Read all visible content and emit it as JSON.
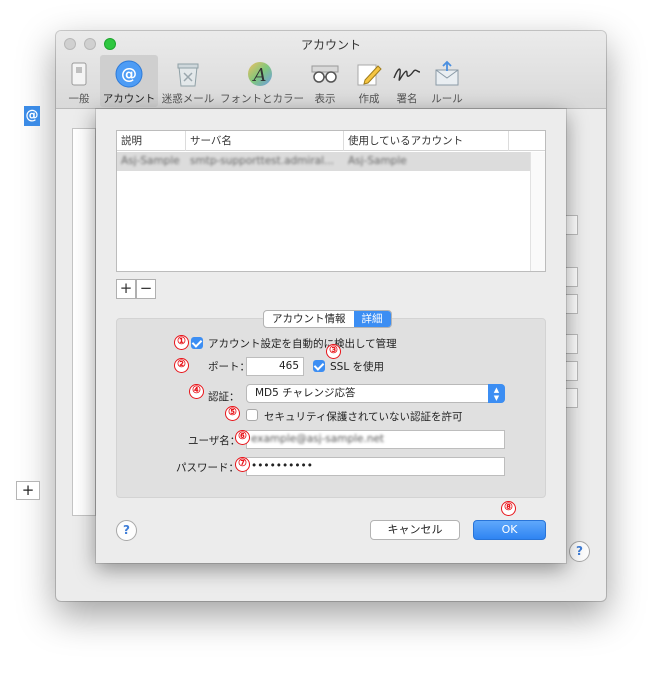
{
  "window": {
    "title": "アカウント",
    "toolbar": [
      {
        "label": "一般",
        "icon": "general-switch-icon"
      },
      {
        "label": "アカウント",
        "icon": "at-sign-icon",
        "selected": true
      },
      {
        "label": "迷惑メール",
        "icon": "junk-mail-bin-icon"
      },
      {
        "label": "フォントとカラー",
        "icon": "font-color-icon"
      },
      {
        "label": "表示",
        "icon": "glasses-icon"
      },
      {
        "label": "作成",
        "icon": "pencil-icon"
      },
      {
        "label": "署名",
        "icon": "signature-icon"
      },
      {
        "label": "ルール",
        "icon": "rules-envelope-icon"
      }
    ],
    "plus_label": "+",
    "help_label": "?"
  },
  "sheet": {
    "table": {
      "columns": [
        "説明",
        "サーバ名",
        "使用しているアカウント"
      ],
      "rows": [
        [
          "Asj-Sample",
          "smtp-supporttest.admiral...",
          "Asj-Sample"
        ]
      ]
    },
    "add_label": "+",
    "remove_label": "−",
    "tabs": [
      {
        "label": "アカウント情報",
        "active": false
      },
      {
        "label": "詳細",
        "active": true
      }
    ],
    "auto_detect_label": "アカウント設定を自動的に検出して管理",
    "auto_detect_checked": true,
    "port_label": "ポート：",
    "port_value": "465",
    "ssl_label": "SSL を使用",
    "ssl_checked": true,
    "auth_label": "認証：",
    "auth_value": "MD5 チャレンジ応答",
    "insecure_label": "セキュリティ保護されていない認証を許可",
    "insecure_checked": false,
    "username_label": "ユーザ名：",
    "username_value": "example@asj-sample.net",
    "password_label": "パスワード：",
    "password_value": "••••••••••",
    "cancel_label": "キャンセル",
    "ok_label": "OK",
    "help_label": "?"
  },
  "annotations": [
    "①",
    "②",
    "③",
    "④",
    "⑤",
    "⑥",
    "⑦",
    "⑧"
  ],
  "colors": {
    "accent": "#3c8ef3",
    "annotation": "#e8141a"
  }
}
